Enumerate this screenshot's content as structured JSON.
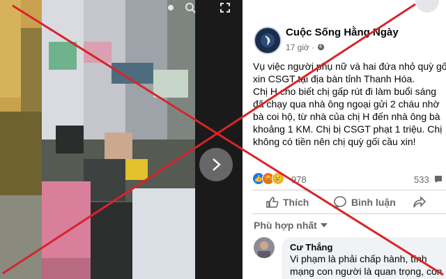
{
  "post": {
    "page_name": "Cuộc Sống Hằng Ngày",
    "time": "17 giờ",
    "body_lines": [
      "Vụ việc người phụ nữ và hai đứa nhỏ quỳ gố",
      "xin CSGT tại địa bàn tỉnh Thanh Hóa.",
      "Chị H cho biết chị gấp rút đi làm buổi sáng",
      "đã chạy qua nhà ông ngoại gửi 2 cháu nhờ",
      "bà coi hộ, từ nhà của chị H đến nhà ông bà",
      "khoảng 1 KM. Chị bị CSGT phạt 1 triệu. Chị",
      "không có tiền nên chị quỳ gối cầu xin!"
    ],
    "reaction_count": "978",
    "comment_count": "533",
    "actions": {
      "like": "Thích",
      "comment": "Bình luận"
    },
    "sort_label": "Phù hợp nhất"
  },
  "comment": {
    "author": "Cư Thắng",
    "lines": [
      "Vi phạm là phải chấp hành, tính",
      "mạng con người là quan trọng, còn"
    ]
  },
  "colors": {
    "overlay_red": "#d8242a",
    "link_blue": "#1877f2",
    "panel_bg": "#ffffff"
  }
}
